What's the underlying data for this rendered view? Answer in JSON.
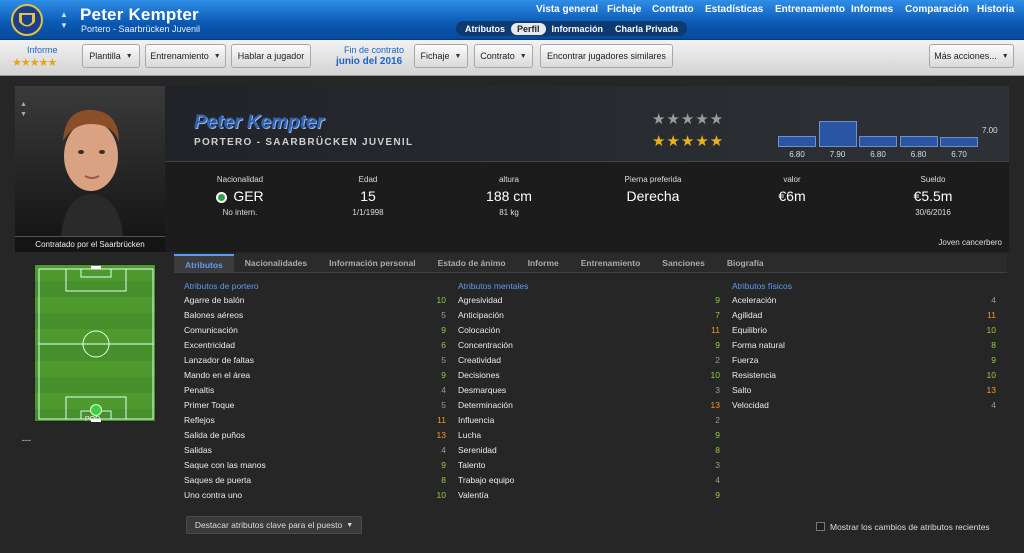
{
  "header": {
    "name": "Peter Kempter",
    "subtitle": "Portero - Saarbrücken Juvenil",
    "nav": [
      "Vista general",
      "Fichaje",
      "Contrato",
      "Estadísticas",
      "Entrenamiento",
      "Informes",
      "Comparación",
      "Historia"
    ],
    "subtabs": [
      "Atributos",
      "Perfil",
      "Información",
      "Charla Privada"
    ],
    "active_subtab": "Perfil"
  },
  "toolbar": {
    "report_label": "Informe",
    "report_stars": "★★★★★",
    "report_stars_value": 4.5,
    "plantilla": "Plantilla",
    "entrenamiento": "Entrenamiento",
    "hablar": "Hablar a jugador",
    "contract_label": "Fin de contrato",
    "contract_value": "junio del 2016",
    "fichaje": "Fichaje",
    "contrato": "Contrato",
    "similares": "Encontrar jugadores similares",
    "mas": "Más acciones..."
  },
  "profile": {
    "name": "Peter Kempter",
    "role": "PORTERO - SAARBRÜCKEN JUVENIL",
    "contract_caption": "Contratado por el Saarbrücken",
    "current_ability_stars": 4.5,
    "potential_ability_stars": 4.5,
    "stars_glyphs": "★★★★★",
    "ratings_reference": "7.00",
    "ratings": [
      6.8,
      7.9,
      6.8,
      6.8,
      6.7
    ],
    "rating_labels": [
      "6.80",
      "7.90",
      "6.80",
      "6.80",
      "6.70"
    ],
    "info": [
      {
        "label": "Nacionalidad",
        "value": "GER",
        "sub": "No intern."
      },
      {
        "label": "Edad",
        "value": "15",
        "sub": "1/1/1998"
      },
      {
        "label": "altura",
        "value": "188 cm",
        "sub": "81 kg"
      },
      {
        "label": "Pierna preferida",
        "value": "Derecha",
        "sub": ""
      },
      {
        "label": "valor",
        "value": "€6m",
        "sub": ""
      },
      {
        "label": "Sueldo",
        "value": "€5.5m",
        "sub": "30/6/2016"
      }
    ],
    "role_line": "Joven cancerbero",
    "position_label": "POR",
    "dash": "---"
  },
  "tabs": [
    "Atributos",
    "Nacionalidades",
    "Información personal",
    "Estado de ánimo",
    "Informe",
    "Entrenamiento",
    "Sanciones",
    "Biografía"
  ],
  "active_tab": "Atributos",
  "attributes": {
    "goalkeeping": {
      "title": "Atributos de portero",
      "items": [
        {
          "name": "Agarre de balón",
          "value": 10
        },
        {
          "name": "Balones aéreos",
          "value": 5
        },
        {
          "name": "Comunicación",
          "value": 9
        },
        {
          "name": "Excentricidad",
          "value": 6
        },
        {
          "name": "Lanzador de faltas",
          "value": 5
        },
        {
          "name": "Mando en el área",
          "value": 9
        },
        {
          "name": "Penaltis",
          "value": 4
        },
        {
          "name": "Primer Toque",
          "value": 5
        },
        {
          "name": "Reflejos",
          "value": 11
        },
        {
          "name": "Salida de puños",
          "value": 13
        },
        {
          "name": "Salidas",
          "value": 4
        },
        {
          "name": "Saque con las manos",
          "value": 9
        },
        {
          "name": "Saques de puerta",
          "value": 8
        },
        {
          "name": "Uno contra uno",
          "value": 10
        }
      ]
    },
    "mental": {
      "title": "Atributos mentales",
      "items": [
        {
          "name": "Agresividad",
          "value": 9
        },
        {
          "name": "Anticipación",
          "value": 7
        },
        {
          "name": "Colocación",
          "value": 11
        },
        {
          "name": "Concentración",
          "value": 9
        },
        {
          "name": "Creatividad",
          "value": 2
        },
        {
          "name": "Decisiones",
          "value": 10
        },
        {
          "name": "Desmarques",
          "value": 3
        },
        {
          "name": "Determinación",
          "value": 13
        },
        {
          "name": "Influencia",
          "value": 2
        },
        {
          "name": "Lucha",
          "value": 9
        },
        {
          "name": "Serenidad",
          "value": 8
        },
        {
          "name": "Talento",
          "value": 3
        },
        {
          "name": "Trabajo equipo",
          "value": 4
        },
        {
          "name": "Valentía",
          "value": 9
        }
      ]
    },
    "physical": {
      "title": "Atributos físicos",
      "items": [
        {
          "name": "Aceleración",
          "value": 4
        },
        {
          "name": "Agilidad",
          "value": 11
        },
        {
          "name": "Equilibrio",
          "value": 10
        },
        {
          "name": "Forma natural",
          "value": 8
        },
        {
          "name": "Fuerza",
          "value": 9
        },
        {
          "name": "Resistencia",
          "value": 10
        },
        {
          "name": "Salto",
          "value": 13
        },
        {
          "name": "Velocidad",
          "value": 4
        }
      ]
    }
  },
  "footer": {
    "highlight_button": "Destacar atributos clave para el puesto",
    "show_changes": "Mostrar los cambios de atributos recientes"
  },
  "colors": {
    "low": "#9a9a9a",
    "mid": "#8fcf3c",
    "high": "#f39a1c"
  }
}
